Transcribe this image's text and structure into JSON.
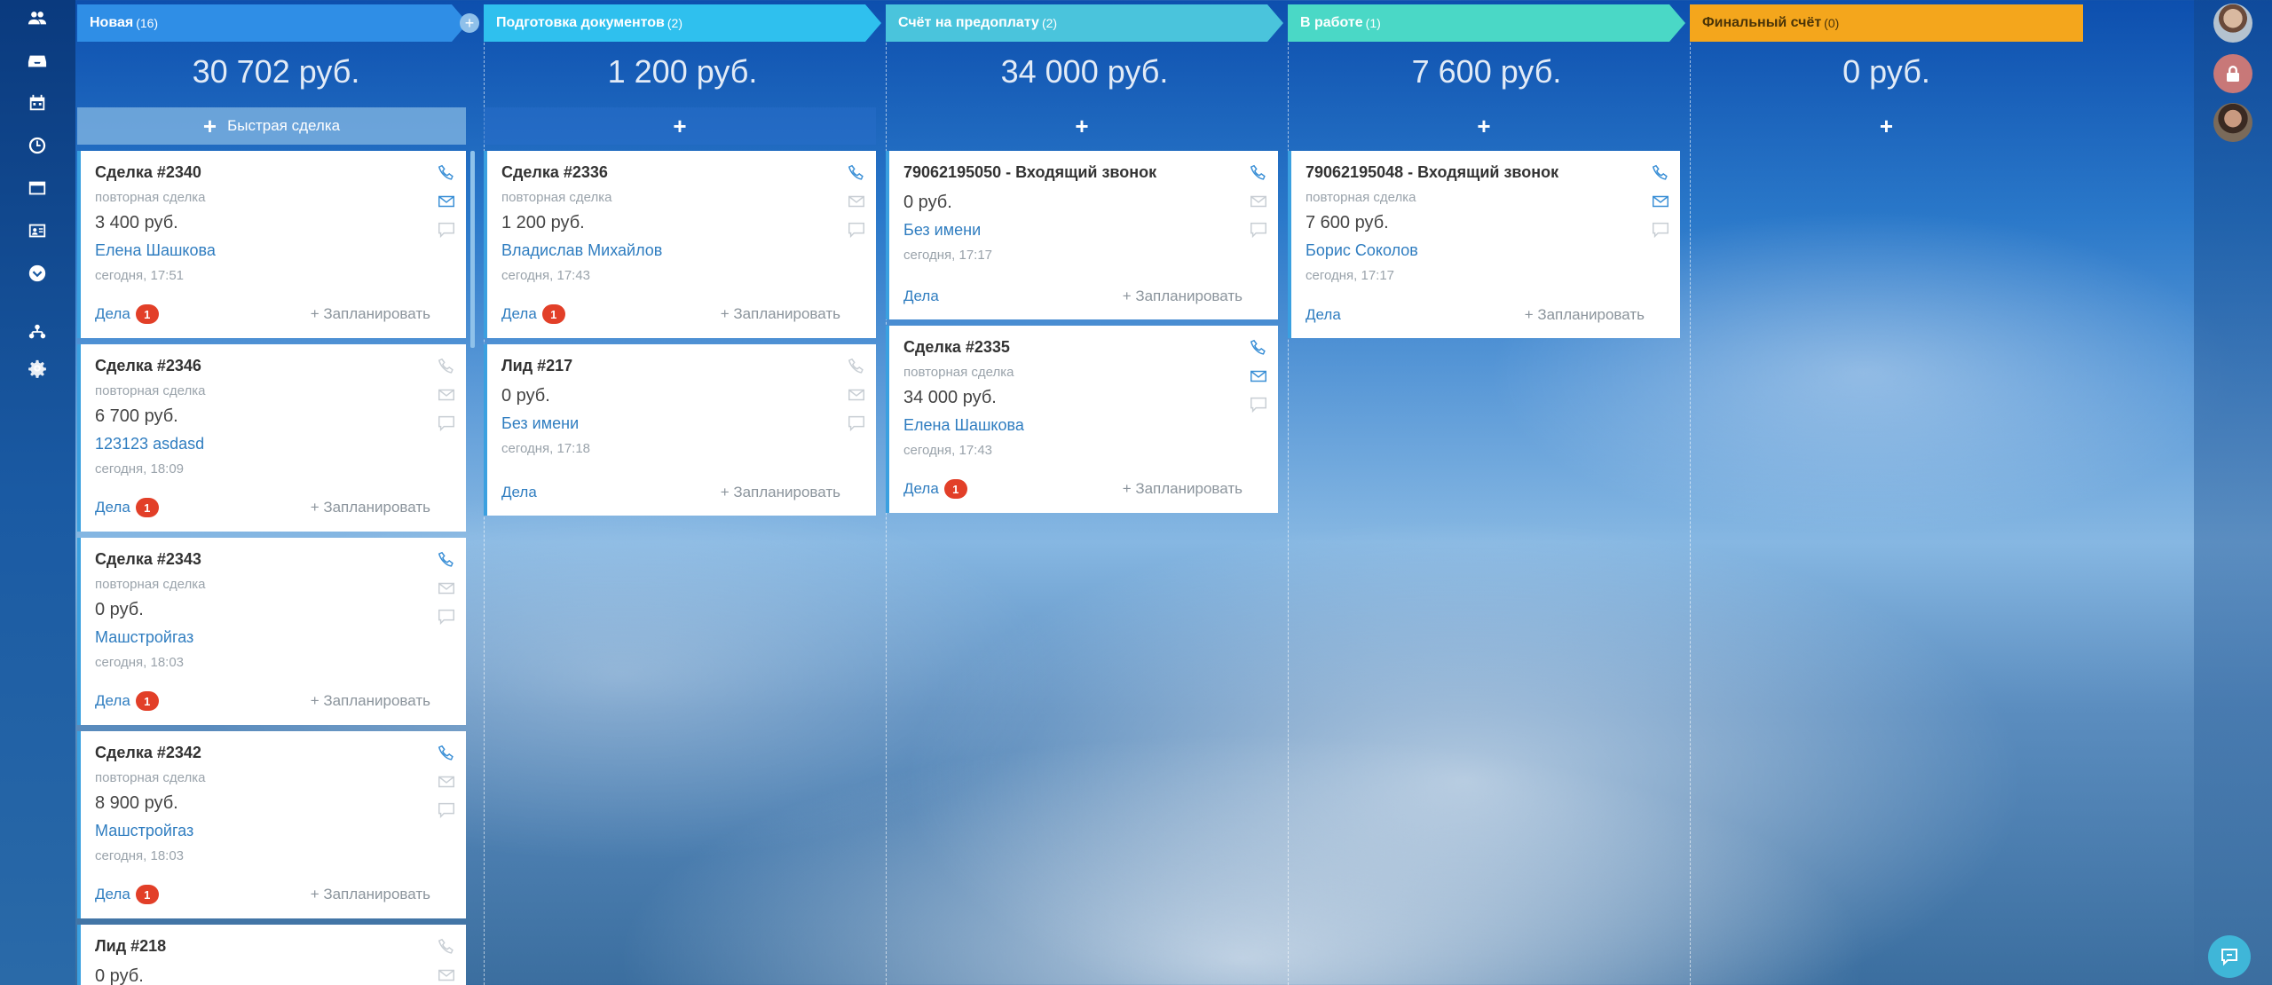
{
  "colors": {
    "col1": "#2f8ee6",
    "col2": "#2fc0ee",
    "col3": "#4ac4dc",
    "col4": "#4ad8c6",
    "col5": "#f4a61c",
    "card_accent": "#3aa0e0",
    "badge": "#e23f28",
    "link": "#2f7dc0"
  },
  "left_nav": [
    {
      "icon": "users-icon"
    },
    {
      "icon": "inbox-icon"
    },
    {
      "icon": "calendar-icon"
    },
    {
      "icon": "clock-icon"
    },
    {
      "icon": "window-icon"
    },
    {
      "icon": "contact-card-icon"
    },
    {
      "icon": "chevron-down-circle-icon"
    },
    {
      "icon": "sitemap-icon"
    },
    {
      "icon": "gear-icon"
    }
  ],
  "columns": [
    {
      "title": "Новая",
      "count": "(16)",
      "sum": "30 702 руб.",
      "add_label": "Быстрая сделка",
      "cards": [
        {
          "title": "Сделка #2340",
          "sub": "повторная сделка",
          "price": "3 400 руб.",
          "contact": "Елена Шашкова",
          "time": "сегодня, 17:51",
          "deals": "Дела",
          "badge": "1",
          "plan": "+ Запланировать"
        },
        {
          "title": "Сделка #2346",
          "sub": "повторная сделка",
          "price": "6 700 руб.",
          "contact": "123123 asdasd",
          "time": "сегодня, 18:09",
          "deals": "Дела",
          "badge": "1",
          "plan": "+ Запланировать"
        },
        {
          "title": "Сделка #2343",
          "sub": "повторная сделка",
          "price": "0 руб.",
          "contact": "Машстройгаз",
          "time": "сегодня, 18:03",
          "deals": "Дела",
          "badge": "1",
          "plan": "+ Запланировать"
        },
        {
          "title": "Сделка #2342",
          "sub": "повторная сделка",
          "price": "8 900 руб.",
          "contact": "Машстройгаз",
          "time": "сегодня, 18:03",
          "deals": "Дела",
          "badge": "1",
          "plan": "+ Запланировать"
        },
        {
          "title": "Лид #218",
          "sub": "",
          "price": "0 руб.",
          "contact": "",
          "time": "",
          "deals": "",
          "badge": "",
          "plan": ""
        }
      ]
    },
    {
      "title": "Подготовка документов",
      "count": "(2)",
      "sum": "1 200 руб.",
      "add_label": "",
      "cards": [
        {
          "title": "Сделка #2336",
          "sub": "повторная сделка",
          "price": "1 200 руб.",
          "contact": "Владислав Михайлов",
          "time": "сегодня, 17:43",
          "deals": "Дела",
          "badge": "1",
          "plan": "+ Запланировать"
        },
        {
          "title": "Лид #217",
          "sub": "",
          "price": "0 руб.",
          "contact": "Без имени",
          "time": "сегодня, 17:18",
          "deals": "Дела",
          "badge": "",
          "plan": "+ Запланировать"
        }
      ]
    },
    {
      "title": "Счёт на предоплату",
      "count": "(2)",
      "sum": "34 000 руб.",
      "add_label": "",
      "cards": [
        {
          "title": "79062195050 - Входящий звонок",
          "sub": "",
          "price": "0 руб.",
          "contact": "Без имени",
          "time": "сегодня, 17:17",
          "deals": "Дела",
          "badge": "",
          "plan": "+ Запланировать"
        },
        {
          "title": "Сделка #2335",
          "sub": "повторная сделка",
          "price": "34 000 руб.",
          "contact": "Елена Шашкова",
          "time": "сегодня, 17:43",
          "deals": "Дела",
          "badge": "1",
          "plan": "+ Запланировать"
        }
      ]
    },
    {
      "title": "В работе",
      "count": "(1)",
      "sum": "7 600 руб.",
      "add_label": "",
      "cards": [
        {
          "title": "79062195048 - Входящий звонок",
          "sub": "повторная сделка",
          "price": "7 600 руб.",
          "contact": "Борис Соколов",
          "time": "сегодня, 17:17",
          "deals": "Дела",
          "badge": "",
          "plan": "+ Запланировать"
        }
      ]
    },
    {
      "title": "Финальный счёт",
      "count": "(0)",
      "sum": "0 руб.",
      "add_label": "",
      "cards": []
    }
  ]
}
